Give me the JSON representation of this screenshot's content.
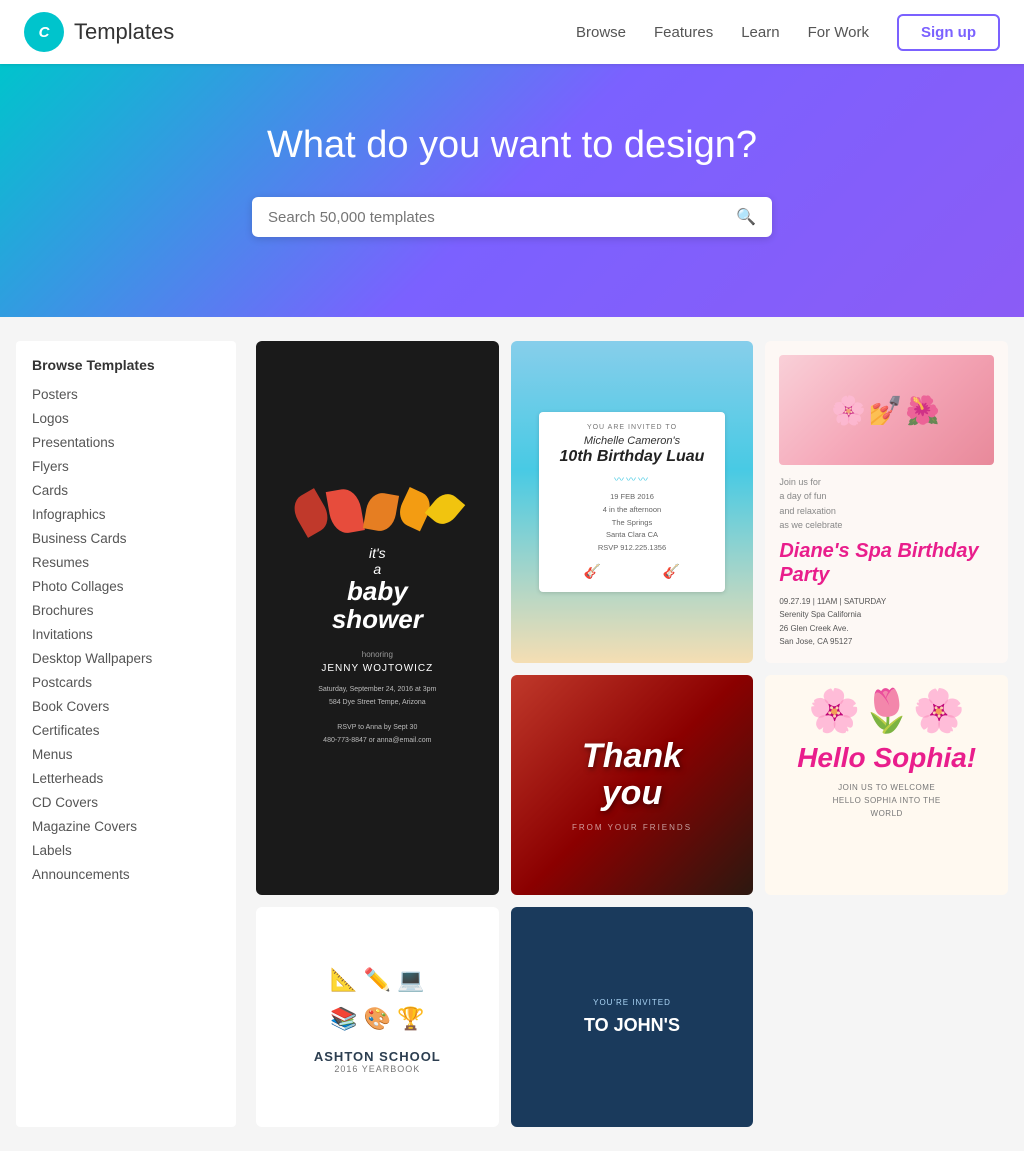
{
  "header": {
    "logo_text": "Canva",
    "title": "Templates",
    "nav": {
      "browse": "Browse",
      "features": "Features",
      "learn": "Learn",
      "for_work": "For Work",
      "signup": "Sign up"
    }
  },
  "hero": {
    "title": "What do you want to design?",
    "search_placeholder": "Search 50,000 templates"
  },
  "sidebar": {
    "heading": "Browse Templates",
    "items": [
      "Posters",
      "Logos",
      "Presentations",
      "Flyers",
      "Cards",
      "Infographics",
      "Business Cards",
      "Resumes",
      "Photo Collages",
      "Brochures",
      "Invitations",
      "Desktop Wallpapers",
      "Postcards",
      "Book Covers",
      "Certificates",
      "Menus",
      "Letterheads",
      "CD Covers",
      "Magazine Covers",
      "Labels",
      "Announcements"
    ]
  },
  "templates": {
    "cards": [
      {
        "id": "baby-shower",
        "type": "dark",
        "title": "it's a baby shower",
        "name": "JENNY WOJTOWICZ",
        "details": "Saturday, September 24, 2016 at 3pm\n584 Dye Street Tempe, Arizona\nRSVP to Anna by Sept 30\n480-773-8847 or anna@email.com"
      },
      {
        "id": "birthday-luau",
        "type": "beach",
        "invited": "YOU ARE INVITED TO",
        "name": "Michelle Cameron's",
        "event": "10th Birthday Luau",
        "date": "19 FEB 2016",
        "details": "4 in the afternoon\nThe Springs\nSanta Clara CA\nRSVP 912.225.1356"
      },
      {
        "id": "thank-you",
        "type": "sunset",
        "text": "Thank you",
        "subtext": "FROM YOUR FRIENDS"
      },
      {
        "id": "spa-birthday",
        "type": "spa",
        "intro": "Join us for\na day of fun\nand relaxation\nas we celebrate",
        "title": "Diane's Spa Birthday Party",
        "date": "09.27.19 | 11AM | SATURDAY",
        "address": "Serenity Spa California\n26 Glen Creek Ave.\nSan Jose, CA 95127"
      },
      {
        "id": "hello-sophia",
        "type": "floral",
        "text": "Hello Sophia!",
        "details": "JOIN US TO WELCOME\nHELLO SOPHIA INTO THE\nWORLD"
      },
      {
        "id": "invitation-johns",
        "type": "navy",
        "invited": "YOU'RE INVITED",
        "name": "TO JOHN'S"
      },
      {
        "id": "school-yearbook",
        "type": "school",
        "name": "ASHTON SCHOOL",
        "year": "2016 YEARBOOK"
      }
    ]
  }
}
